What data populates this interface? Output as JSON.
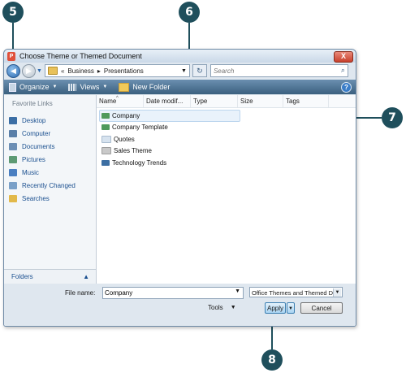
{
  "window": {
    "title": "Choose Theme or Themed Document",
    "close_glyph": "X"
  },
  "callouts": [
    "5",
    "6",
    "7",
    "8"
  ],
  "address": {
    "crumb_sep": "«",
    "crumbs": [
      "Business",
      "Presentations"
    ],
    "arrow": "▸"
  },
  "search": {
    "placeholder": "Search"
  },
  "toolbar": {
    "organize": "Organize",
    "views": "Views",
    "new_folder": "New Folder"
  },
  "nav": {
    "heading": "Favorite Links",
    "items": [
      {
        "label": "Desktop",
        "icon": "desktop-icon",
        "color": "#3b6ea5"
      },
      {
        "label": "Computer",
        "icon": "computer-icon",
        "color": "#5a7fa8"
      },
      {
        "label": "Documents",
        "icon": "documents-icon",
        "color": "#6d8fb5"
      },
      {
        "label": "Pictures",
        "icon": "pictures-icon",
        "color": "#5d9a74"
      },
      {
        "label": "Music",
        "icon": "music-icon",
        "color": "#4a7fc1"
      },
      {
        "label": "Recently Changed",
        "icon": "recent-icon",
        "color": "#7aa0c8"
      },
      {
        "label": "Searches",
        "icon": "searches-icon",
        "color": "#e2b94a"
      }
    ],
    "folders_label": "Folders"
  },
  "columns": [
    "Name",
    "Date modif...",
    "Type",
    "Size",
    "Tags"
  ],
  "files": [
    {
      "name": "Company",
      "icon": "theme-file-icon",
      "color": "#4f9a5c",
      "selected": true
    },
    {
      "name": "Company Template",
      "icon": "theme-file-icon",
      "color": "#4f9a5c"
    },
    {
      "name": "Quotes",
      "icon": "folder-icon",
      "color": "#d7e3ef"
    },
    {
      "name": "Sales Theme",
      "icon": "folder-icon",
      "color": "#c9c9c9"
    },
    {
      "name": "Technology Trends",
      "icon": "theme-file-icon",
      "color": "#3d6fa3"
    }
  ],
  "footer": {
    "file_name_label": "File name:",
    "file_name_value": "Company",
    "file_type": "Office Themes and Themed D",
    "tools_label": "Tools",
    "apply_label": "Apply",
    "cancel_label": "Cancel"
  },
  "colors": {
    "callout": "#1f4f5c",
    "toolbar": "#4a6f90",
    "link": "#1a4f8f"
  }
}
